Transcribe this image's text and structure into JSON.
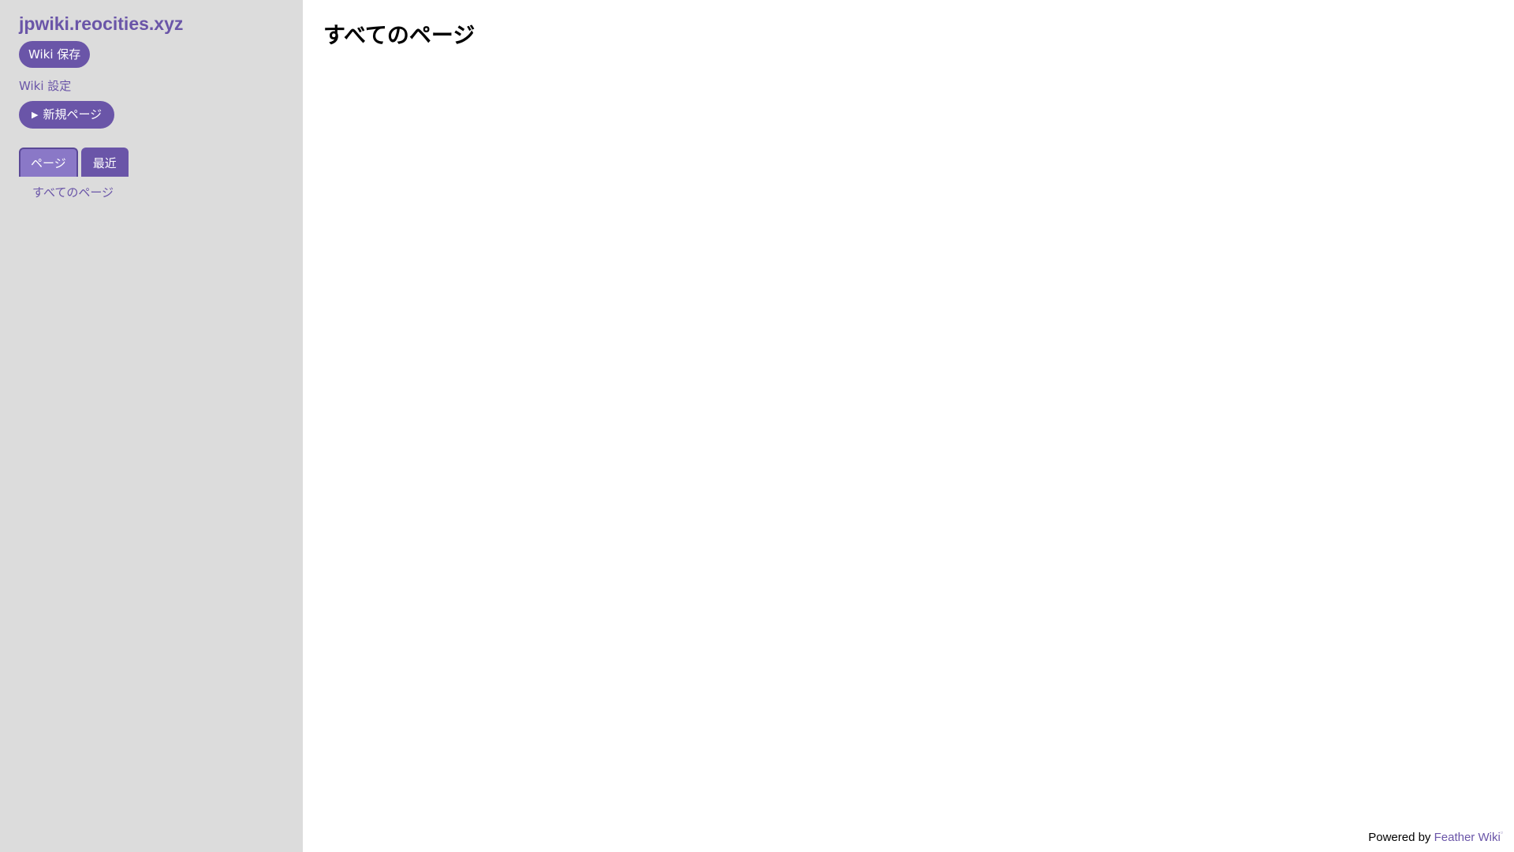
{
  "sidebar": {
    "site_title": "jpwiki.reocities.xyz",
    "save_button": "Wiki 保存",
    "settings_link": "Wiki 設定",
    "new_page_button": "新規ページ",
    "tabs": [
      {
        "label": "ページ",
        "active": true
      },
      {
        "label": "最近",
        "active": false
      }
    ],
    "pages": [
      {
        "label": "すべてのページ"
      }
    ]
  },
  "main": {
    "title": "すべてのページ"
  },
  "footer": {
    "prefix": "Powered by",
    "link": "Feather Wiki"
  },
  "colors": {
    "accent": "#6a55a8",
    "sidebar_bg": "#dcdcdc",
    "active_tab": "#8a78c7"
  }
}
